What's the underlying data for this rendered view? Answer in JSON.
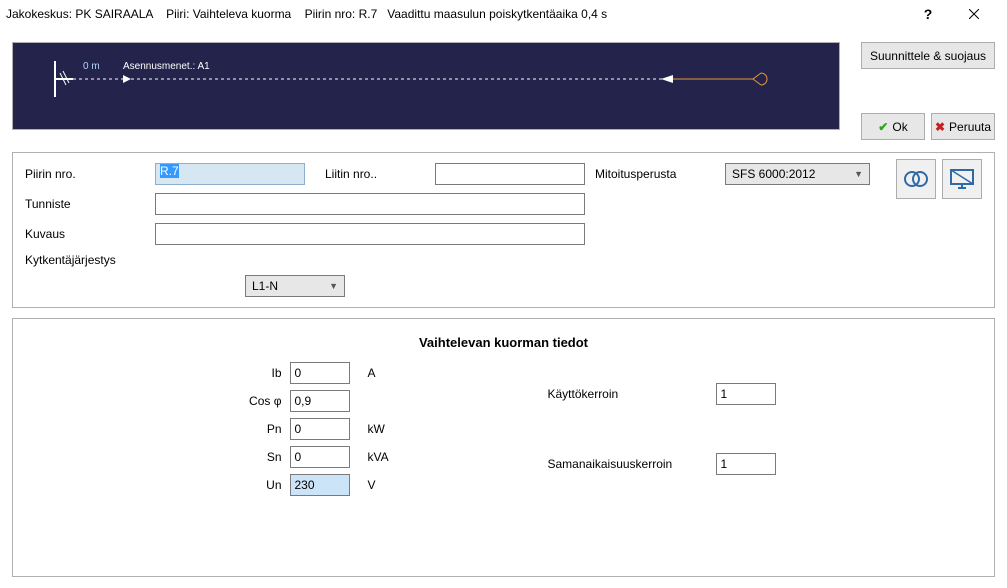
{
  "window": {
    "title": "Jakokeskus: PK SAIRAALA    Piiri: Vaihteleva kuorma    Piirin nro: R.7   Vaadittu maasulun poiskytkentäaika 0,4 s"
  },
  "buttons": {
    "design": "Suunnittele & suojaus",
    "ok": "Ok",
    "cancel": "Peruuta"
  },
  "diagram": {
    "span_label": "0 m",
    "install_label": "Asennusmenet.: A1"
  },
  "labels": {
    "circuit_no": "Piirin nro.",
    "terminal_no": "Liitin nro..",
    "sizing_basis": "Mitoitusperusta",
    "identifier": "Tunniste",
    "description": "Kuvaus",
    "switching": "Kytkentäjärjestys",
    "section_title": "Vaihtelevan kuorman tiedot",
    "ib": "Ib",
    "cosphi": "Cos φ",
    "pn": "Pn",
    "sn": "Sn",
    "un": "Un",
    "unit_A": "A",
    "unit_kW": "kW",
    "unit_kVA": "kVA",
    "unit_V": "V",
    "util": "Käyttökerroin",
    "coincidence": "Samanaikaisuuskerroin"
  },
  "values": {
    "circuit_no": "R.7",
    "terminal_no": "",
    "sizing_basis": "SFS 6000:2012",
    "identifier": "",
    "description": "",
    "switching": "L1-N",
    "ib": "0",
    "cosphi": "0,9",
    "pn": "0",
    "sn": "0",
    "un": "230",
    "util": "1",
    "coincidence": "1"
  }
}
